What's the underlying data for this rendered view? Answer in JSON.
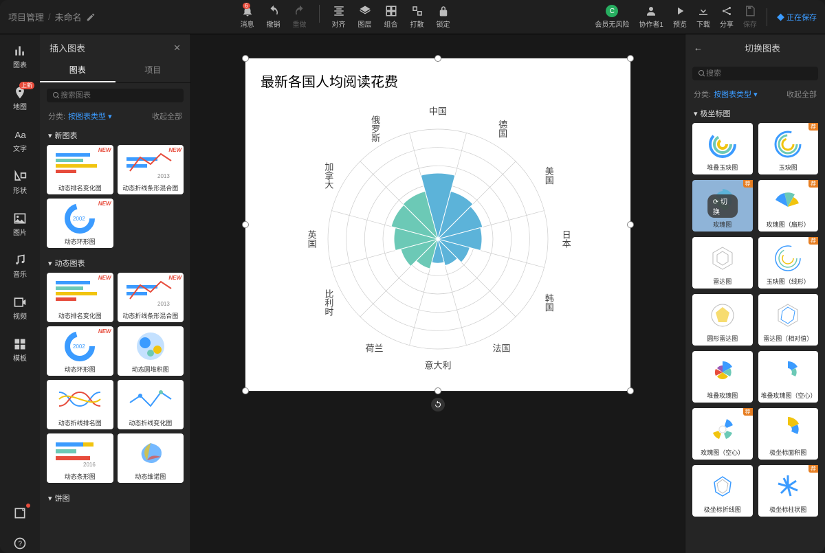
{
  "breadcrumb": {
    "project": "项目管理",
    "doc": "未命名"
  },
  "toolbar": {
    "message": "消息",
    "message_badge": "6",
    "undo": "撤销",
    "redo": "重做",
    "align": "对齐",
    "layer": "图层",
    "group": "组合",
    "ungroup": "打散",
    "lock": "锁定",
    "vip": "会员无风险",
    "collab": "协作者1",
    "preview": "预览",
    "download": "下载",
    "share": "分享",
    "save": "保存",
    "saving": "正在保存"
  },
  "leftStrip": {
    "chart": "图表",
    "map": "地图",
    "map_badge": "上新",
    "text": "文字",
    "shape": "形状",
    "image": "图片",
    "music": "音乐",
    "video": "视频",
    "template": "模板"
  },
  "leftPanel": {
    "title": "插入图表",
    "tabs": {
      "chart": "图表",
      "project": "项目"
    },
    "search_placeholder": "搜索图表",
    "filter_label": "分类:",
    "filter_value": "按图表类型",
    "collapse": "收起全部",
    "cat_new": "新图表",
    "cat_dynamic": "动态图表",
    "cat_pie": "饼图",
    "new_tag": "NEW",
    "tiles": {
      "dyn_rank": "动态排名变化图",
      "dyn_line_bar": "动态折线条形混合图",
      "dyn_ring": "动态环形图",
      "dyn_circle_stack": "动态圆堆积图",
      "dyn_line_rank": "动态折线排名图",
      "dyn_line_change": "动态折线变化图",
      "dyn_bar": "动态条形图",
      "dyn_venn": "动态维诺图"
    }
  },
  "rightPanel": {
    "title": "切换图表",
    "search_placeholder": "搜索",
    "filter_label": "分类:",
    "filter_value": "按图表类型",
    "collapse": "收起全部",
    "cat_polar": "极坐标图",
    "switch_label": "切换",
    "rec_tag": "荐",
    "tiles": {
      "stack_jade": "堆叠玉玦图",
      "jade": "玉玦图",
      "rose": "玫瑰图",
      "rose_fan": "玫瑰图（扇形）",
      "radar": "雷达图",
      "jade_line": "玉玦图（线形）",
      "circle_radar": "圆形雷达图",
      "radar_rel": "雷达图（相对值）",
      "stack_rose": "堆叠玫瑰图",
      "stack_rose_hollow": "堆叠玫瑰图（空心）",
      "rose_hollow": "玫瑰图（空心）",
      "polar_area": "极坐标面积图",
      "polar_line": "极坐标折线图",
      "polar_bar": "极坐标柱状图"
    }
  },
  "chart_data": {
    "type": "polar-rose",
    "title": "最新各国人均阅读花费",
    "categories_cw_from_top": [
      "中国",
      "德国",
      "美国",
      "日本",
      "韩国",
      "法国",
      "意大利",
      "荷兰",
      "比利时",
      "英国",
      "加拿大",
      "俄罗斯"
    ],
    "values": [
      60,
      45,
      42,
      40,
      30,
      25,
      22,
      28,
      35,
      40,
      44,
      45
    ],
    "value_range": [
      0,
      100
    ],
    "rings": 6,
    "colors": {
      "right_half": "#5cb3d9",
      "left_half": "#6cc9b6"
    }
  }
}
